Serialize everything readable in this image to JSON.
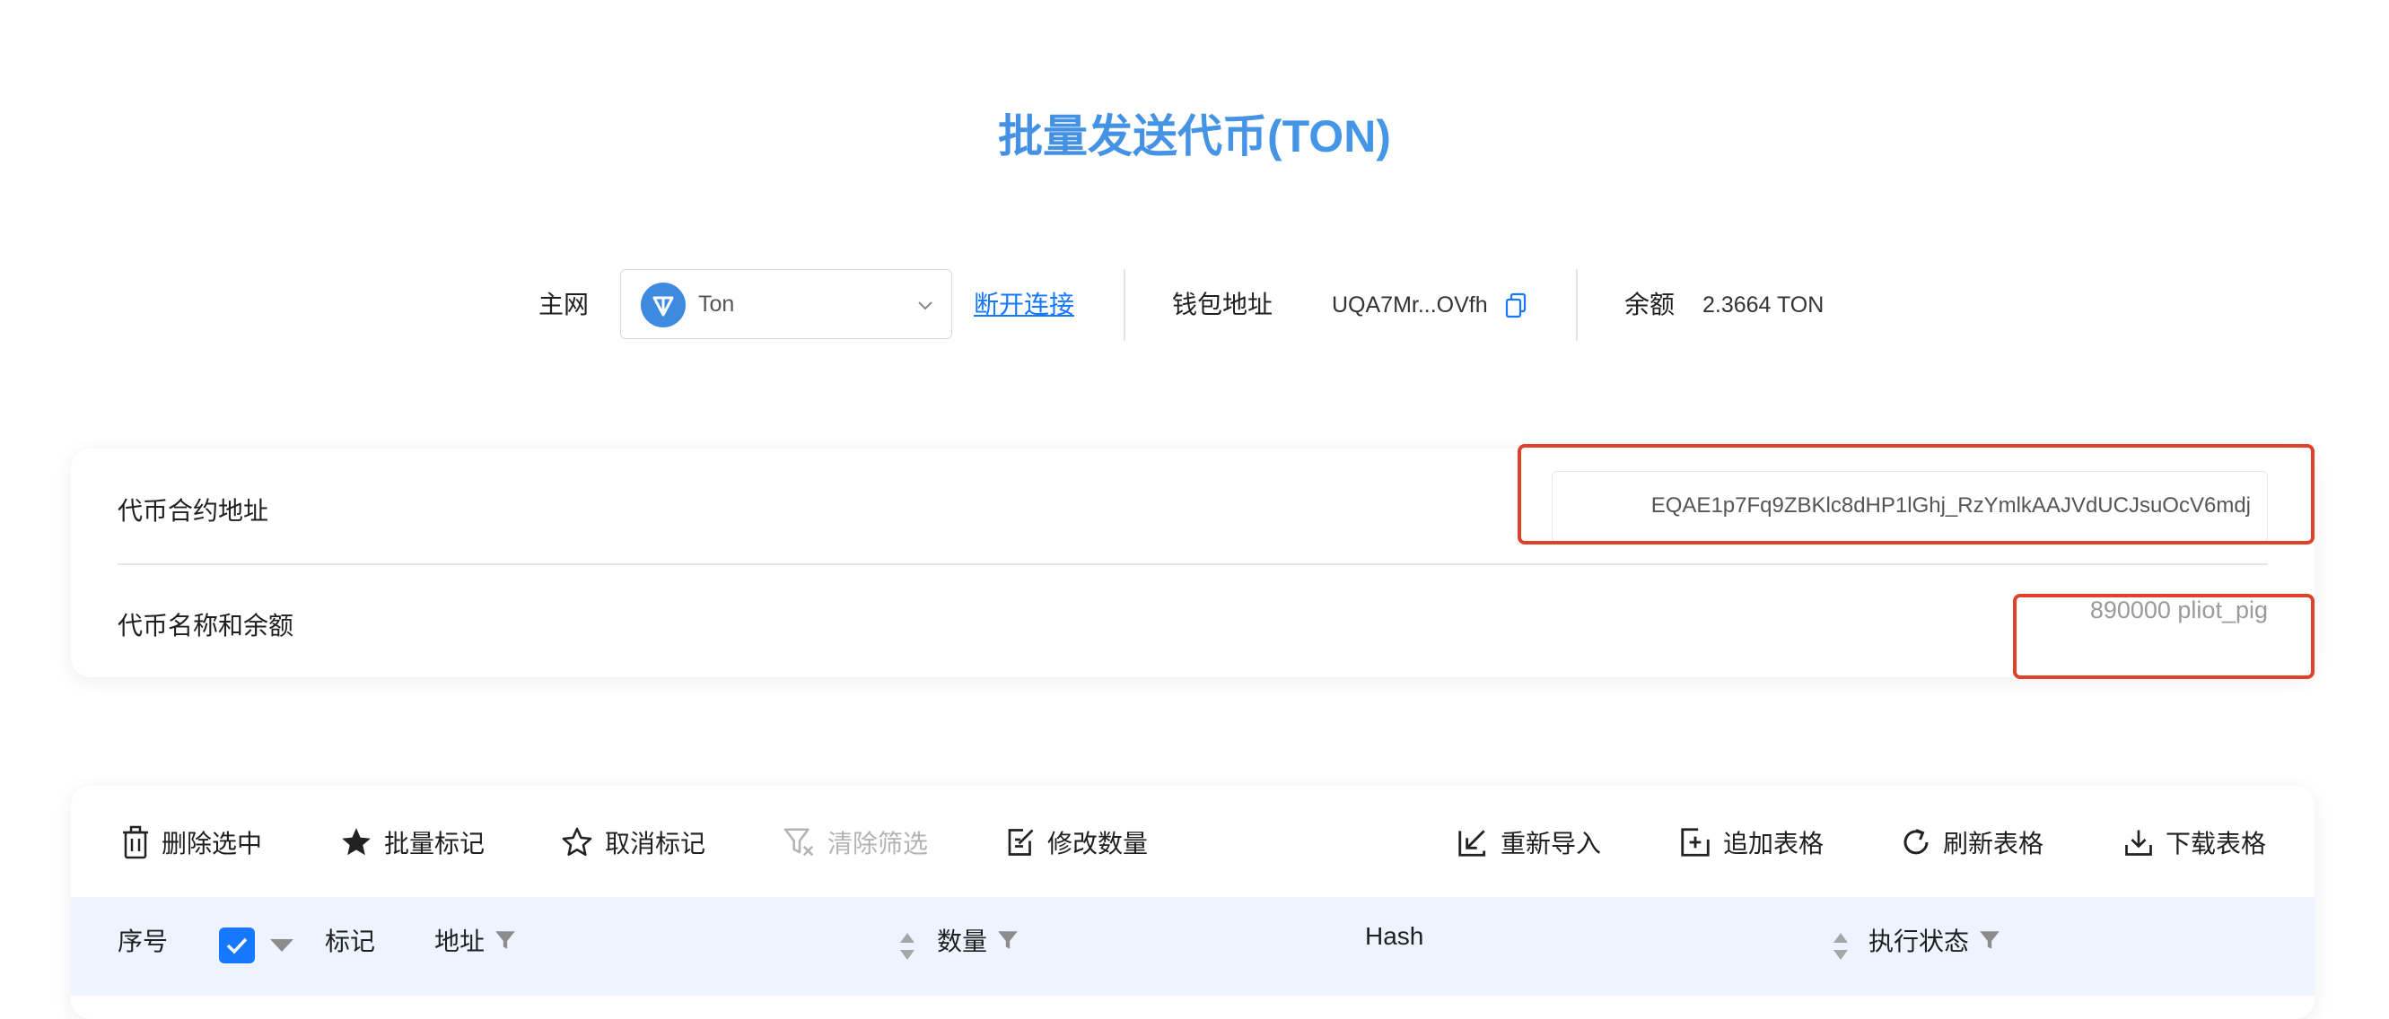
{
  "page": {
    "title": "批量发送代币(TON)"
  },
  "connection": {
    "network_label": "主网",
    "network_value": "Ton",
    "disconnect_label": "断开连接",
    "wallet_label": "钱包地址",
    "wallet_address": "UQA7Mr...OVfh",
    "balance_label": "余额",
    "balance_value": "2.3664 TON"
  },
  "token": {
    "contract_label": "代币合约地址",
    "contract_value": "EQAE1p7Fq9ZBKlc8dHP1lGhj_RzYmlkAAJVdUCJsuOcV6mdj",
    "name_label": "代币名称和余额",
    "name_value": "890000 pliot_pig"
  },
  "toolbar": {
    "delete_selected": "删除选中",
    "batch_mark": "批量标记",
    "unmark": "取消标记",
    "clear_filter": "清除筛选",
    "edit_quantity": "修改数量",
    "reimport": "重新导入",
    "append_table": "追加表格",
    "refresh_table": "刷新表格",
    "download_table": "下载表格"
  },
  "table": {
    "columns": {
      "index": "序号",
      "mark": "标记",
      "address": "地址",
      "quantity": "数量",
      "hash": "Hash",
      "status": "执行状态"
    }
  },
  "colors": {
    "accent": "#1677ff",
    "highlight": "#e0412b",
    "header_bg": "#eef4ff"
  }
}
